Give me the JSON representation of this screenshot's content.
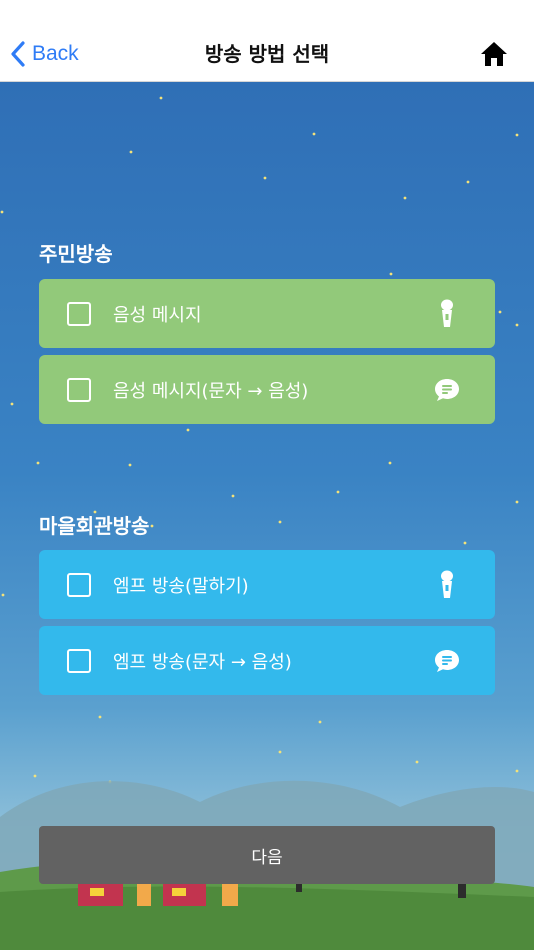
{
  "nav": {
    "back_label": "Back",
    "title": "방송 방법 선택"
  },
  "sections": [
    {
      "title": "주민방송",
      "options": [
        {
          "label": "음성 메시지",
          "icon": "microphone-icon",
          "checked": false
        },
        {
          "label": "음성 메시지(문자 → 음성)",
          "icon": "chat-bubble-icon",
          "checked": false
        }
      ]
    },
    {
      "title": "마을회관방송",
      "options": [
        {
          "label": "엠프 방송(말하기)",
          "icon": "microphone-icon",
          "checked": false
        },
        {
          "label": "엠프 방송(문자 → 음성)",
          "icon": "chat-bubble-icon",
          "checked": false
        }
      ]
    }
  ],
  "next_label": "다음",
  "colors": {
    "accent": "#2f7cf6",
    "resident_option": "#92c97a",
    "hall_option": "#33b9ec",
    "next_button": "#626262"
  }
}
